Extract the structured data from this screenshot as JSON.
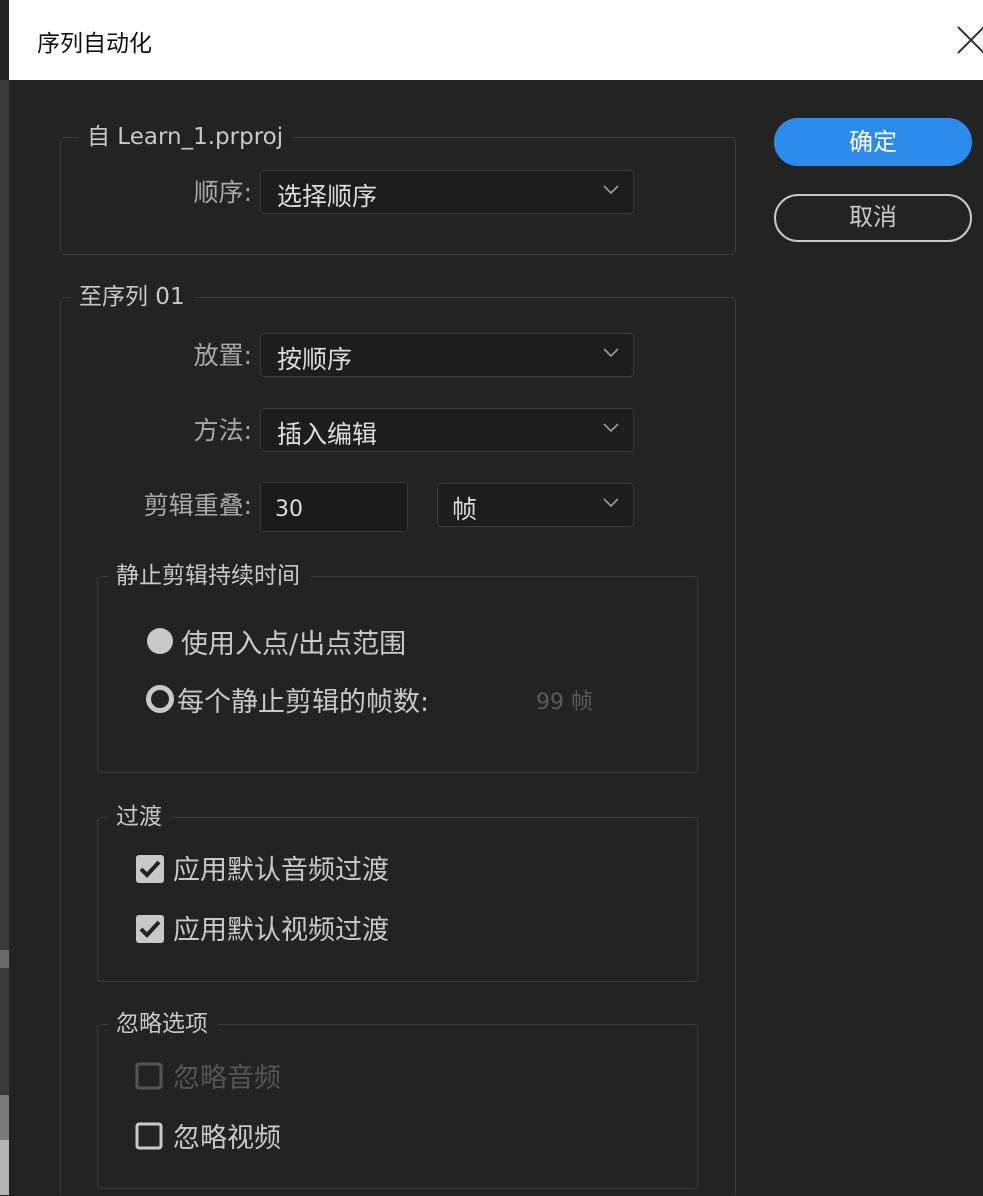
{
  "dialog": {
    "title": "序列自动化"
  },
  "from_group": {
    "legend": "自 Learn_1.prproj",
    "order_label": "顺序:",
    "order_value": "选择顺序"
  },
  "to_group": {
    "legend": "至序列 01",
    "placement_label": "放置:",
    "placement_value": "按顺序",
    "method_label": "方法:",
    "method_value": "插入编辑",
    "overlap_label": "剪辑重叠:",
    "overlap_value": "30",
    "overlap_unit": "帧"
  },
  "still_group": {
    "legend": "静止剪辑持续时间",
    "option_inout": {
      "label": "使用入点/出点范围",
      "selected": true
    },
    "option_frames": {
      "label": "每个静止剪辑的帧数:",
      "selected": false,
      "value": "99 帧"
    }
  },
  "transition_group": {
    "legend": "过渡",
    "audio": {
      "label": "应用默认音频过渡",
      "checked": true
    },
    "video": {
      "label": "应用默认视频过渡",
      "checked": true
    }
  },
  "ignore_group": {
    "legend": "忽略选项",
    "audio": {
      "label": "忽略音频",
      "checked": false,
      "disabled": true
    },
    "video": {
      "label": "忽略视频",
      "checked": false,
      "disabled": false
    }
  },
  "buttons": {
    "ok": "确定",
    "cancel": "取消"
  },
  "colors": {
    "accent": "#2d8ceb",
    "background": "#232323",
    "titlebar": "#ffffff"
  }
}
